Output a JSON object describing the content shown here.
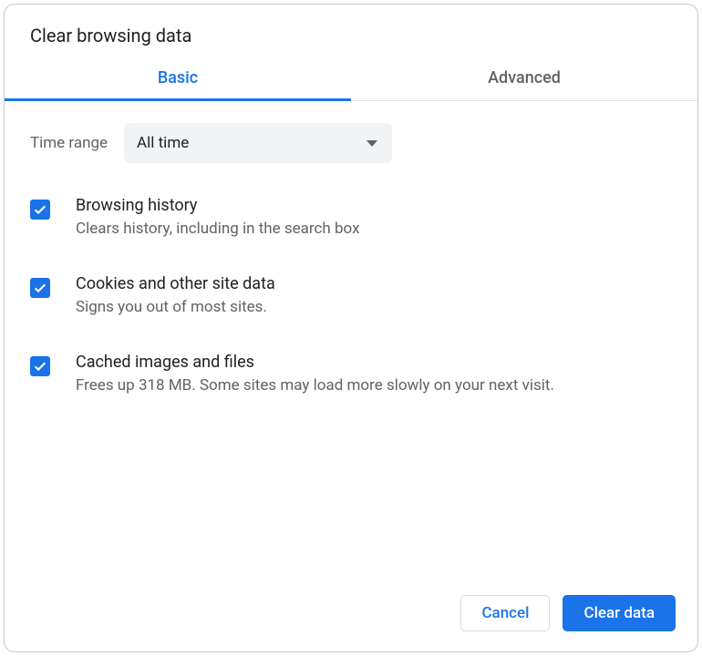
{
  "dialog": {
    "title": "Clear browsing data"
  },
  "tabs": {
    "basic": "Basic",
    "advanced": "Advanced"
  },
  "time_range": {
    "label": "Time range",
    "selected": "All time"
  },
  "options": {
    "browsing_history": {
      "title": "Browsing history",
      "desc": "Clears history, including in the search box"
    },
    "cookies": {
      "title": "Cookies and other site data",
      "desc": "Signs you out of most sites."
    },
    "cache": {
      "title": "Cached images and files",
      "desc": "Frees up 318 MB. Some sites may load more slowly on your next visit."
    }
  },
  "buttons": {
    "cancel": "Cancel",
    "clear": "Clear data"
  }
}
